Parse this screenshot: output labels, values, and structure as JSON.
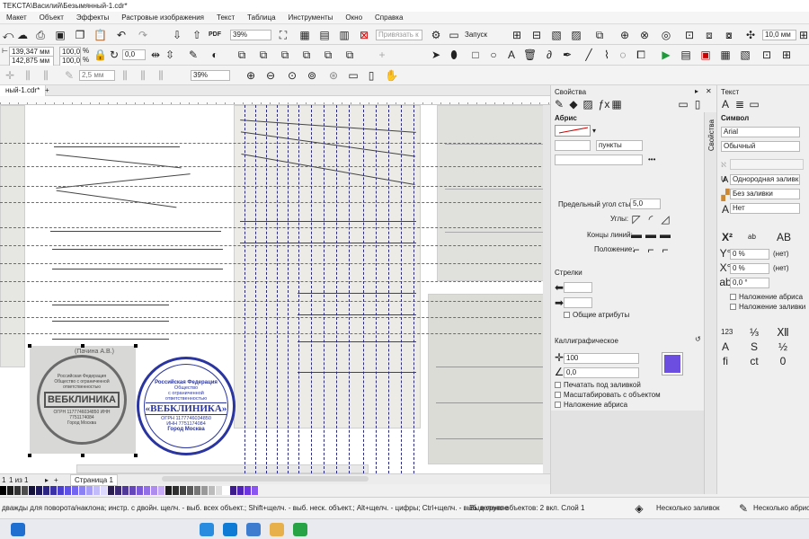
{
  "window": {
    "title": "TEKCTA\\Василий\\Безымянный-1.cdr*"
  },
  "menu": [
    "Макет",
    "Объект",
    "Эффекты",
    "Растровые изображения",
    "Текст",
    "Таблица",
    "Инструменты",
    "Окно",
    "Справка"
  ],
  "toolbar": {
    "zoom": "39%",
    "launch": "Запуск",
    "snap": "Привязать к",
    "nudge": "10,0 мм",
    "pdf": "PDF"
  },
  "propbar": {
    "x": "139,347 мм",
    "y": "142,875 мм",
    "scale_w": "100,0",
    "scale_h": "100,0",
    "percent": "%",
    "rotate": "0,0",
    "outline_width": "2,5 мм",
    "zoom2": "39%"
  },
  "document": {
    "tab": "ный-1.cdr*"
  },
  "stamps": {
    "left": {
      "top_name": "(Пачина А.В.)",
      "ring": "Российская Федерация Общество с ограниченной ответственностью",
      "brand": "ВЕБКЛИНИКА",
      "ogrn": "ОГРН 1177746034850 ИНН 7751174084",
      "city": "Город Москва"
    },
    "right": {
      "ring": "Российская Федерация",
      "line1": "Общество",
      "line2": "с ограниченной",
      "line3": "ответственностью",
      "brand": "«ВЕБКЛИНИКА»",
      "ogrn": "ОГРН 1177746034850",
      "inn": "ИНН 7751174084",
      "city": "Город Москва"
    }
  },
  "properties_panel": {
    "title": "Свойства",
    "outline_title": "Абрис",
    "units": "пункты",
    "miter_label": "Предельный угол стыка:",
    "miter_value": "5,0",
    "corners_label": "Углы:",
    "caps_label": "Концы линий:",
    "position_label": "Положение:",
    "arrows_title": "Стрелки",
    "shared_attrs": "Общие атрибуты",
    "calligraphic_title": "Каллиграфическое",
    "stretch_value": "100",
    "angle_value": "0,0",
    "print_under_fill": "Печатать под заливкой",
    "scale_with_object": "Масштабировать с объектом",
    "overprint_outline": "Наложение абриса",
    "side_tab": "Свойства",
    "outline_color": "#6c4ee0"
  },
  "text_panel": {
    "title": "Текст",
    "symbol_title": "Символ",
    "font": "Arial",
    "style": "Обычный",
    "fill_type": "Однородная заливка",
    "bg_fill": "Без заливки",
    "outline": "Нет",
    "x_offset": "0 %",
    "y_offset": "0 %",
    "rotation": "0,0 °",
    "overprint_outline": "Наложение абриса",
    "overprint_fill": "Наложение заливки",
    "none_1": "(нет)",
    "none_2": "(нет)",
    "script_ab": "ab",
    "num_123": "123"
  },
  "page_nav": {
    "page_count": "1 из 1",
    "page_name": "Страница 1"
  },
  "status": {
    "hint": "дважды для поворота/наклона; инстр. с двойн. щелч. - выб. всех объект.; Shift+щелч. - выб. неск. объект.; Alt+щелч. - цифры; Ctrl+щелч. - выб. в группе",
    "selection": "Выделено объектов: 2 вкл. Слой 1",
    "fill_info": "Несколько заливок",
    "outline_info": "Несколько абрисов"
  },
  "palette_colors": [
    "#000000",
    "#1a1a1a",
    "#333333",
    "#4d4d4d",
    "#14113a",
    "#1e1a5c",
    "#2c2582",
    "#3a31a8",
    "#4b3fcf",
    "#5e51e6",
    "#7466f0",
    "#8c80f5",
    "#a79ef8",
    "#c3bcfb",
    "#ddd8fd",
    "#2a1f4f",
    "#3b2a73",
    "#4f3897",
    "#6547bb",
    "#7c59d8",
    "#9470e6",
    "#ad8cee",
    "#c6aaf5",
    "#1c1c1c",
    "#2e2e2e",
    "#444",
    "#5a5a5a",
    "#777",
    "#999",
    "#bbb",
    "#ddd",
    "#fff",
    "#3d1b8a",
    "#5022b8",
    "#6b34de",
    "#8a55f0"
  ]
}
